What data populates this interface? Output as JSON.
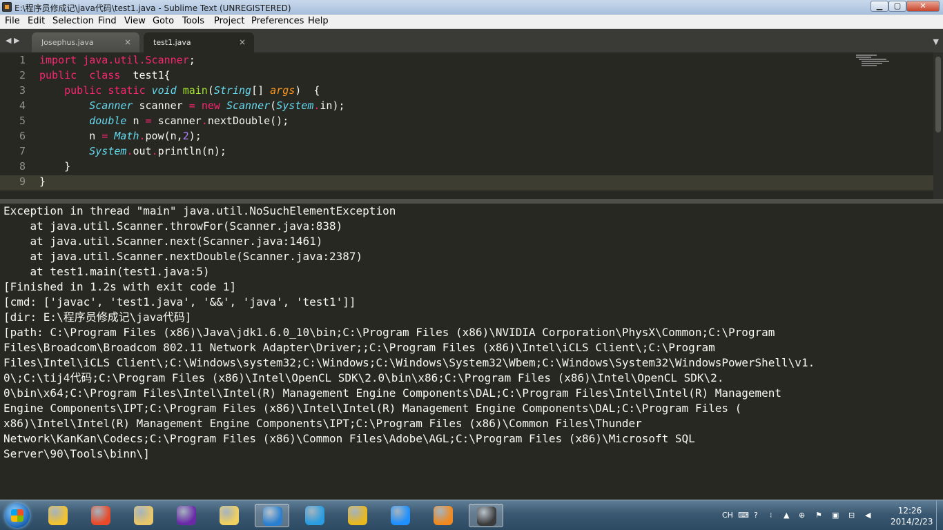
{
  "window": {
    "title": "E:\\程序员修成记\\java代码\\test1.java - Sublime Text (UNREGISTERED)",
    "min_glyph": "▁",
    "max_glyph": "▢",
    "close_glyph": "✕"
  },
  "menu": [
    "File",
    "Edit",
    "Selection",
    "Find",
    "View",
    "Goto",
    "Tools",
    "Project",
    "Preferences",
    "Help"
  ],
  "tabs": {
    "nav_glyph": "◀ ▶",
    "menu_glyph": "▼",
    "close_glyph": "×",
    "items": [
      {
        "label": "Josephus.java",
        "active": false
      },
      {
        "label": "test1.java",
        "active": true
      }
    ]
  },
  "editor": {
    "line_numbers": [
      "1",
      "2",
      "3",
      "4",
      "5",
      "6",
      "7",
      "8",
      "9"
    ],
    "current_line": 9,
    "lines": [
      [
        {
          "t": "import",
          "c": "#f92672"
        },
        {
          "t": " ",
          "c": "#f8f8f2"
        },
        {
          "t": "java.util.Scanner",
          "c": "#f92672"
        },
        {
          "t": ";",
          "c": "#f8f8f2"
        }
      ],
      [
        {
          "t": "public",
          "c": "#f92672"
        },
        {
          "t": "  ",
          "c": "#f8f8f2"
        },
        {
          "t": "class",
          "c": "#f92672"
        },
        {
          "t": "  test1{",
          "c": "#f8f8f2"
        }
      ],
      [
        {
          "t": "    ",
          "c": "#f8f8f2"
        },
        {
          "t": "public",
          "c": "#f92672"
        },
        {
          "t": " ",
          "c": "#f8f8f2"
        },
        {
          "t": "static",
          "c": "#f92672"
        },
        {
          "t": " ",
          "c": "#f8f8f2"
        },
        {
          "t": "void",
          "c": "#66d9ef",
          "i": true
        },
        {
          "t": " ",
          "c": "#f8f8f2"
        },
        {
          "t": "main",
          "c": "#a6e22e"
        },
        {
          "t": "(",
          "c": "#f8f8f2"
        },
        {
          "t": "String",
          "c": "#66d9ef",
          "i": true
        },
        {
          "t": "[] ",
          "c": "#f8f8f2"
        },
        {
          "t": "args",
          "c": "#fd971f",
          "i": true
        },
        {
          "t": ")  {",
          "c": "#f8f8f2"
        }
      ],
      [
        {
          "t": "        ",
          "c": "#f8f8f2"
        },
        {
          "t": "Scanner",
          "c": "#66d9ef",
          "i": true
        },
        {
          "t": " scanner ",
          "c": "#f8f8f2"
        },
        {
          "t": "=",
          "c": "#f92672"
        },
        {
          "t": " ",
          "c": "#f8f8f2"
        },
        {
          "t": "new",
          "c": "#f92672"
        },
        {
          "t": " ",
          "c": "#f8f8f2"
        },
        {
          "t": "Scanner",
          "c": "#66d9ef",
          "i": true
        },
        {
          "t": "(",
          "c": "#f8f8f2"
        },
        {
          "t": "System",
          "c": "#66d9ef",
          "i": true
        },
        {
          "t": ".",
          "c": "#f92672"
        },
        {
          "t": "in);",
          "c": "#f8f8f2"
        }
      ],
      [
        {
          "t": "        ",
          "c": "#f8f8f2"
        },
        {
          "t": "double",
          "c": "#66d9ef",
          "i": true
        },
        {
          "t": " n ",
          "c": "#f8f8f2"
        },
        {
          "t": "=",
          "c": "#f92672"
        },
        {
          "t": " scanner",
          "c": "#f8f8f2"
        },
        {
          "t": ".",
          "c": "#f92672"
        },
        {
          "t": "nextDouble();",
          "c": "#f8f8f2"
        }
      ],
      [
        {
          "t": "        n ",
          "c": "#f8f8f2"
        },
        {
          "t": "=",
          "c": "#f92672"
        },
        {
          "t": " ",
          "c": "#f8f8f2"
        },
        {
          "t": "Math",
          "c": "#66d9ef",
          "i": true
        },
        {
          "t": ".",
          "c": "#f92672"
        },
        {
          "t": "pow(n,",
          "c": "#f8f8f2"
        },
        {
          "t": "2",
          "c": "#ae81ff"
        },
        {
          "t": ");",
          "c": "#f8f8f2"
        }
      ],
      [
        {
          "t": "        ",
          "c": "#f8f8f2"
        },
        {
          "t": "System",
          "c": "#66d9ef",
          "i": true
        },
        {
          "t": ".",
          "c": "#f92672"
        },
        {
          "t": "out",
          "c": "#f8f8f2"
        },
        {
          "t": ".",
          "c": "#f92672"
        },
        {
          "t": "println(n);",
          "c": "#f8f8f2"
        }
      ],
      [
        {
          "t": "    }",
          "c": "#f8f8f2"
        }
      ],
      [
        {
          "t": "}",
          "c": "#f8f8f2"
        }
      ]
    ]
  },
  "console": {
    "lines": [
      "Exception in thread \"main\" java.util.NoSuchElementException",
      "    at java.util.Scanner.throwFor(Scanner.java:838)",
      "    at java.util.Scanner.next(Scanner.java:1461)",
      "    at java.util.Scanner.nextDouble(Scanner.java:2387)",
      "    at test1.main(test1.java:5)",
      "[Finished in 1.2s with exit code 1]",
      "[cmd: ['javac', 'test1.java', '&&', 'java', 'test1']]",
      "[dir: E:\\程序员修成记\\java代码]",
      "[path: C:\\Program Files (x86)\\Java\\jdk1.6.0_10\\bin;C:\\Program Files (x86)\\NVIDIA Corporation\\PhysX\\Common;C:\\Program",
      "Files\\Broadcom\\Broadcom 802.11 Network Adapter\\Driver;;C:\\Program Files (x86)\\Intel\\iCLS Client\\;C:\\Program",
      "Files\\Intel\\iCLS Client\\;C:\\Windows\\system32;C:\\Windows;C:\\Windows\\System32\\Wbem;C:\\Windows\\System32\\WindowsPowerShell\\v1.",
      "0\\;C:\\tij4代码;C:\\Program Files (x86)\\Intel\\OpenCL SDK\\2.0\\bin\\x86;C:\\Program Files (x86)\\Intel\\OpenCL SDK\\2.",
      "0\\bin\\x64;C:\\Program Files\\Intel\\Intel(R) Management Engine Components\\DAL;C:\\Program Files\\Intel\\Intel(R) Management",
      "Engine Components\\IPT;C:\\Program Files (x86)\\Intel\\Intel(R) Management Engine Components\\DAL;C:\\Program Files (",
      "x86)\\Intel\\Intel(R) Management Engine Components\\IPT;C:\\Program Files (x86)\\Common Files\\Thunder",
      "Network\\KanKan\\Codecs;C:\\Program Files (x86)\\Common Files\\Adobe\\AGL;C:\\Program Files (x86)\\Microsoft SQL",
      "Server\\90\\Tools\\binn\\]"
    ]
  },
  "taskbar": {
    "icons": [
      {
        "name": "pinwheel-app-icon",
        "color": "#f2c230"
      },
      {
        "name": "paint-app-icon",
        "color": "#e84a2a"
      },
      {
        "name": "screenshot-app-icon",
        "color": "#e8c76a"
      },
      {
        "name": "media-swirl-app-icon",
        "color": "#6a2aa8"
      },
      {
        "name": "search-magnifier-app-icon",
        "color": "#f0d060"
      },
      {
        "name": "sogou-app-icon",
        "color": "#2a7fd0"
      },
      {
        "name": "cloud-app-icon",
        "color": "#2a9de0"
      },
      {
        "name": "e-browser-app-icon",
        "color": "#e8b820"
      },
      {
        "name": "player-app-icon",
        "color": "#1e90ff"
      },
      {
        "name": "kankan-app-icon",
        "color": "#f08a20"
      },
      {
        "name": "sublime-text-app-icon",
        "color": "#3b3b3b"
      }
    ],
    "tray_lang": "CH",
    "clock_time": "12:26",
    "clock_date": "2014/2/23"
  }
}
